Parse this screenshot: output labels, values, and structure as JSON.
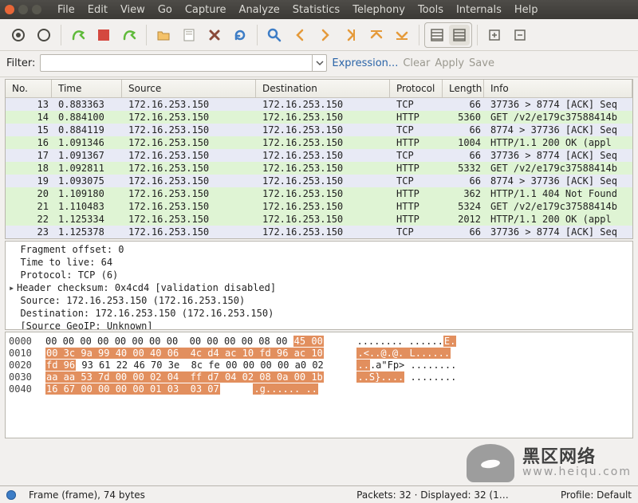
{
  "menu": {
    "items_0": "File",
    "items_1": "Edit",
    "items_2": "View",
    "items_3": "Go",
    "items_4": "Capture",
    "items_5": "Analyze",
    "items_6": "Statistics",
    "items_7": "Telephony",
    "items_8": "Tools",
    "items_9": "Internals",
    "items_10": "Help"
  },
  "filterbar": {
    "label": "Filter:",
    "filter_value": "",
    "expression": "Expression...",
    "clear": "Clear",
    "apply": "Apply",
    "save": "Save"
  },
  "columns": {
    "no": "No.",
    "time": "Time",
    "source": "Source",
    "dest": "Destination",
    "proto": "Protocol",
    "length": "Length",
    "info": "Info"
  },
  "packets": [
    {
      "no": "13",
      "time": "0.883363",
      "src": "172.16.253.150",
      "dst": "172.16.253.150",
      "proto": "TCP",
      "len": "66",
      "info": "37736 > 8774 [ACK] Seq",
      "cls": "lightblue"
    },
    {
      "no": "14",
      "time": "0.884100",
      "src": "172.16.253.150",
      "dst": "172.16.253.150",
      "proto": "HTTP",
      "len": "5360",
      "info": "GET /v2/e179c37588414b",
      "cls": "green"
    },
    {
      "no": "15",
      "time": "0.884119",
      "src": "172.16.253.150",
      "dst": "172.16.253.150",
      "proto": "TCP",
      "len": "66",
      "info": "8774 > 37736 [ACK] Seq",
      "cls": "lightblue"
    },
    {
      "no": "16",
      "time": "1.091346",
      "src": "172.16.253.150",
      "dst": "172.16.253.150",
      "proto": "HTTP",
      "len": "1004",
      "info": "HTTP/1.1 200 OK  (appl",
      "cls": "green"
    },
    {
      "no": "17",
      "time": "1.091367",
      "src": "172.16.253.150",
      "dst": "172.16.253.150",
      "proto": "TCP",
      "len": "66",
      "info": "37736 > 8774 [ACK] Seq",
      "cls": "lightblue"
    },
    {
      "no": "18",
      "time": "1.092811",
      "src": "172.16.253.150",
      "dst": "172.16.253.150",
      "proto": "HTTP",
      "len": "5332",
      "info": "GET /v2/e179c37588414b",
      "cls": "green"
    },
    {
      "no": "19",
      "time": "1.093075",
      "src": "172.16.253.150",
      "dst": "172.16.253.150",
      "proto": "TCP",
      "len": "66",
      "info": "8774 > 37736 [ACK] Seq",
      "cls": "lightblue"
    },
    {
      "no": "20",
      "time": "1.109180",
      "src": "172.16.253.150",
      "dst": "172.16.253.150",
      "proto": "HTTP",
      "len": "362",
      "info": "HTTP/1.1 404 Not Found",
      "cls": "green"
    },
    {
      "no": "21",
      "time": "1.110483",
      "src": "172.16.253.150",
      "dst": "172.16.253.150",
      "proto": "HTTP",
      "len": "5324",
      "info": "GET /v2/e179c37588414b",
      "cls": "green"
    },
    {
      "no": "22",
      "time": "1.125334",
      "src": "172.16.253.150",
      "dst": "172.16.253.150",
      "proto": "HTTP",
      "len": "2012",
      "info": "HTTP/1.1 200 OK  (appl",
      "cls": "green"
    },
    {
      "no": "23",
      "time": "1.125378",
      "src": "172.16.253.150",
      "dst": "172.16.253.150",
      "proto": "TCP",
      "len": "66",
      "info": "37736 > 8774 [ACK] Seq",
      "cls": "lightblue"
    }
  ],
  "details": {
    "l0": "  Fragment offset: 0",
    "l1": "  Time to live: 64",
    "l2": "  Protocol: TCP (6)",
    "l3": "Header checksum: 0x4cd4 [validation disabled]",
    "l4": "  Source: 172.16.253.150 (172.16.253.150)",
    "l5": "  Destination: 172.16.253.150 (172.16.253.150)",
    "l6": "  [Source GeoIP: Unknown]"
  },
  "hex": {
    "rows": [
      {
        "off": "0000",
        "bytes_a": "00 00 00 00 00 00 00 00",
        "bytes_b": "00 00 00 00 08 00",
        "bytes_c": "45 00",
        "ascii_a": "........ ......",
        "ascii_b": "E."
      },
      {
        "off": "0010",
        "bytes_a": "00 3c 9a 99 40 00 40 06",
        "bytes_b": "4c d4 ac 10 fd 96 ac 10",
        "ascii_a": ".<..@.@. L......",
        "ascii_b": ""
      },
      {
        "off": "0020",
        "bytes_a": "fd 96",
        "bytes_b": "93 61 22 46 70 3e",
        "bytes_c": "8c fe 00 00 00 00 a0 02",
        "ascii_a": "..",
        "ascii_b": ".a\"Fp>",
        "ascii_c": "........"
      },
      {
        "off": "0030",
        "bytes_a": "aa aa 53 7d 00 00 02 04",
        "bytes_b": "ff d7 04 02 08 0a 00 1b",
        "ascii_a": "..S}....",
        "ascii_b": "........"
      },
      {
        "off": "0040",
        "bytes_a": "16 67 00 00 00 00 01 03",
        "bytes_b": "03 07",
        "ascii_a": ".g...... ..",
        "ascii_b": ""
      }
    ]
  },
  "status": {
    "frame": "Frame (frame), 74 bytes",
    "packets": "Packets: 32 · Displayed: 32 (1…",
    "profile": "Profile: Default"
  },
  "watermark": {
    "line1": "黑区网络",
    "line2": "www.heiqu.com"
  }
}
